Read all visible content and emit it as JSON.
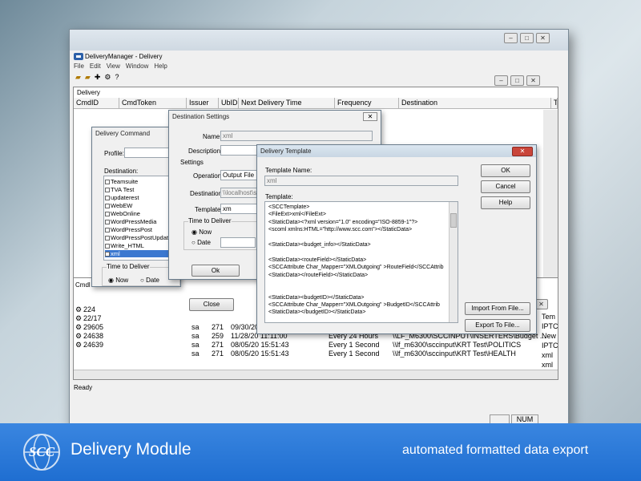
{
  "app": {
    "title": "DeliveryManager - Delivery",
    "menu": [
      "File",
      "Edit",
      "View",
      "Window",
      "Help"
    ],
    "child_title": "Delivery",
    "columns": [
      "CmdID",
      "CmdToken",
      "Issuer",
      "UbID",
      "Next Delivery Time",
      "Frequency",
      "Destination",
      "T"
    ],
    "status": "Ready",
    "num_indicator": "NUM"
  },
  "log": {
    "header_left": "Cmdl",
    "rows": [
      {
        "id": "224",
        "issuer": "",
        "ubid": "",
        "time": "",
        "freq": "",
        "dest": ""
      },
      {
        "id": "22/17",
        "issuer": "",
        "ubid": "",
        "time": "",
        "freq": "",
        "dest": ""
      },
      {
        "id": "29605",
        "issuer": "sa",
        "ubid": "271",
        "time": "09/30/20 11:11:00",
        "freq": "",
        "dest": ""
      },
      {
        "id": "24638",
        "issuer": "sa",
        "ubid": "259",
        "time": "11/28/20 11:11:00",
        "freq": "Every 24 Hours",
        "dest": "\\\\LF_M6300\\SCCINPUT\\INSERTERS\\Budget ..."
      },
      {
        "id": "24639",
        "issuer": "sa",
        "ubid": "271",
        "time": "08/05/20 15:51:43",
        "freq": "Every 1 Second",
        "dest": "\\\\lf_m6300\\sccinput\\KRT Test\\POLITICS"
      },
      {
        "id": "",
        "issuer": "sa",
        "ubid": "271",
        "time": "08/05/20 15:51:43",
        "freq": "Every 1 Second",
        "dest": "\\\\lf_m6300\\sccinput\\KRT Test\\HEALTH"
      }
    ],
    "right_col": [
      "Tem",
      "IPTC",
      "New",
      "IPTC",
      "xml",
      "xml"
    ]
  },
  "cmd_dialog": {
    "title": "Delivery Command",
    "profile_label": "Profile:",
    "destination_label": "Destination:",
    "destinations": [
      "Teamsuite",
      "TVA Test",
      "updaterest",
      "WebEW",
      "WebOnline",
      "WordPressMedia",
      "WordPressPost",
      "WordPressPostUpdate",
      "Write_HTML",
      "xml"
    ],
    "selected_destination": "xml",
    "time_group_label": "Time to Deliver",
    "now_label": "Now",
    "date_label": "Date",
    "close_label": "Close"
  },
  "dest_dialog": {
    "title": "Destination Settings",
    "name_label": "Name:",
    "name_value": "xml",
    "description_label": "Description:",
    "settings_label": "Settings",
    "operation_label": "Operation:",
    "operation_value": "Output File",
    "destination_label": "Destination:",
    "destination_value": "\\\\localhost\\scc",
    "template_label": "Template:",
    "template_value": "xm",
    "time_group_label": "Time to Deliver",
    "now_label": "Now",
    "date_label": "Date",
    "ok_label": "Ok"
  },
  "tpl_dialog": {
    "title": "Delivery Template",
    "name_label": "Template Name:",
    "name_value": "xml",
    "template_label": "Template:",
    "lines": [
      "<SCCTemplate>",
      "<FileExt>xml</FileExt>",
      "<StaticData><?xml version=\"1.0\" encoding=\"ISO-8859-1\"?>",
      "<scoml xmlns:HTML=\"http://www.scc.com\"></StaticData>",
      "",
      "<StaticData><budget_info></StaticData>",
      "",
      "<StaticData><routeField></StaticData>",
      "<SCCAttribute Char_Mapper=\"XMLOutgoing\" >RouteField</SCCAttrib",
      "<StaticData></routeField></StaticData>",
      "",
      "",
      "<StaticData><budgetID></StaticData>",
      "<SCCAttribute Char_Mapper=\"XMLOutgoing\" >BudgetID</SCCAttrib",
      "<StaticData></budgetID></StaticData>"
    ],
    "ok_label": "OK",
    "cancel_label": "Cancel",
    "help_label": "Help",
    "import_label": "Import From File...",
    "export_label": "Export To File..."
  },
  "banner": {
    "logo_text": "SCC",
    "title": "Delivery Module",
    "tagline": "automated formatted data export"
  }
}
